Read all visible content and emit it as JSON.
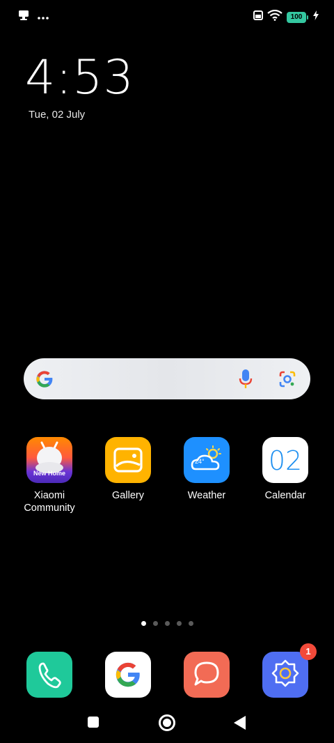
{
  "status_bar": {
    "battery_level": "100",
    "icons": [
      "desktop-notification-icon",
      "more-dots-icon",
      "sim-card-icon",
      "wifi-icon",
      "charging-bolt-icon"
    ]
  },
  "clock": {
    "time": "4:53",
    "date": "Tue, 02 July"
  },
  "search_bar": {
    "icons": [
      "google-g-icon",
      "microphone-icon",
      "google-lens-icon"
    ]
  },
  "apps": [
    {
      "label": "Xiaomi\nCommunity",
      "icon": "xiaomi-community-icon",
      "icon_text": "New Home",
      "color": "#7b3fd0"
    },
    {
      "label": "Gallery",
      "icon": "gallery-icon",
      "color": "#ffb300"
    },
    {
      "label": "Weather",
      "icon": "weather-icon",
      "icon_text": "24°",
      "color": "#1e90ff"
    },
    {
      "label": "Calendar",
      "icon": "calendar-icon",
      "icon_text": "02",
      "color": "#ffffff"
    }
  ],
  "page_indicator": {
    "pages": 5,
    "current": 1
  },
  "dock": [
    {
      "icon": "phone-icon",
      "color": "#1fc99a"
    },
    {
      "icon": "google-app-icon",
      "color": "#ffffff"
    },
    {
      "icon": "messages-icon",
      "color": "#f26b55"
    },
    {
      "icon": "settings-icon",
      "color": "#4f6ef2",
      "badge": "1"
    }
  ],
  "nav_bar": {
    "icons": [
      "recents-square-icon",
      "home-circle-icon",
      "back-triangle-icon"
    ]
  }
}
